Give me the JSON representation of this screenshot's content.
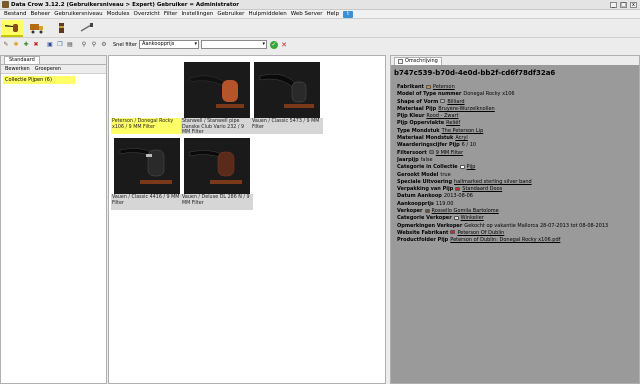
{
  "window": {
    "title": "Data Crow 3.12.2    (Gebruikersniveau > Expert)    Gebruiker = Administrator",
    "minimize_icon": "minimize-icon",
    "maximize_icon": "maximize-icon",
    "close_icon": "close-icon"
  },
  "menubar": {
    "items": [
      "Bestand",
      "Beheer",
      "Gebruikersniveau",
      "Modules",
      "Overzicht",
      "Filter",
      "Instellingen",
      "Gebruiker",
      "Hulpmiddelen",
      "Web Server",
      "Help"
    ],
    "twitter_icon": "twitter-icon"
  },
  "modules": [
    {
      "name": "pipe-module-icon",
      "active": true,
      "color": "#8a4a1a"
    },
    {
      "name": "truck-module-icon",
      "active": false,
      "color": "#b36a10"
    },
    {
      "name": "tobacco-module-icon",
      "active": false,
      "color": "#5a3a20"
    },
    {
      "name": "pipe-tools-module-icon",
      "active": false,
      "color": "#6e6e6e"
    }
  ],
  "toolbar": {
    "filter_label": "Snel filter",
    "filter_field": "Aankoopprijs",
    "filter_value": ""
  },
  "left": {
    "tab": "Standaard",
    "actions": [
      "Bewerken",
      "Groeperen"
    ],
    "tree_item": "Collectie Pijpen (6)"
  },
  "cards": [
    {
      "caption": "Peterson / Donegal Rocky x106 / 9 MM Filter",
      "selected": true,
      "col": 0,
      "row": 0,
      "blank": true,
      "bowl": "#000"
    },
    {
      "caption": "Stanwell / Stanwell pipe Danske Club Vario 232 / 9 MM Filter",
      "selected": false,
      "col": 1,
      "row": 0,
      "blank": false,
      "bowl": "#b5542a"
    },
    {
      "caption": "Vauen / Classic 5473 / 9 MM Filter",
      "selected": false,
      "col": 2,
      "row": 0,
      "blank": false,
      "bowl": "#2a2a2a"
    },
    {
      "caption": "Vauen / Classic 4416 / 9 MM Filter",
      "selected": false,
      "col": 0,
      "row": 1,
      "blank": false,
      "bowl": "#2a2a2a"
    },
    {
      "caption": "Vauen / Deluxe DL 286 N / 9 MM Filter",
      "selected": false,
      "col": 1,
      "row": 1,
      "blank": false,
      "bowl": "#5a2a1a"
    }
  ],
  "right": {
    "tab": "Omschrijving",
    "id": "b747c539-b70d-4e0d-bb2f-cd6f78df32a6",
    "details": [
      {
        "label": "Fabrikant",
        "value": "Peterson",
        "link": true,
        "icon": "#c89040"
      },
      {
        "label": "Model of Type nummer",
        "value": "Donegal Rocky x106",
        "link": false,
        "icon": ""
      },
      {
        "label": "Shape of Vorm",
        "value": "Billiard",
        "link": true,
        "icon": "#b0b0b0"
      },
      {
        "label": "Materiaal Pijp",
        "value": "Bruyère-Wurzelknollen",
        "link": true,
        "icon": ""
      },
      {
        "label": "Pijp Kleur",
        "value": "Rood - Zwart",
        "link": true,
        "icon": ""
      },
      {
        "label": "Pijp Oppervlakte",
        "value": "Reliëf",
        "link": true,
        "icon": ""
      },
      {
        "label": "Type Mondstuk",
        "value": "The Peterson Lip",
        "link": true,
        "icon": ""
      },
      {
        "label": "Materiaal Mondstuk",
        "value": "Acryl",
        "link": true,
        "icon": ""
      },
      {
        "label": "Waarderingscijfer Pijp",
        "value": "6 / 10",
        "link": false,
        "icon": ""
      },
      {
        "label": "Filtersoort",
        "value": "9 MM Filter",
        "link": true,
        "icon": "#7a7a7a"
      },
      {
        "label": "Jaarpijp",
        "value": "false",
        "link": false,
        "icon": ""
      },
      {
        "label": "Categorie in Collectie",
        "value": "Pijp",
        "link": true,
        "icon": "#ffffff"
      },
      {
        "label": "Gerookt Model",
        "value": "true",
        "link": false,
        "icon": ""
      },
      {
        "label": "Speciale Uitvoering",
        "value": "hallmarked sterling silver band",
        "link": true,
        "icon": ""
      },
      {
        "label": "Verpakking van Pijp",
        "value": "Standaard Doos",
        "link": true,
        "icon": "#c03030"
      },
      {
        "label": "Datum Aankoop",
        "value": "2013-08-06",
        "link": false,
        "icon": ""
      },
      {
        "label": "Aankoopprijs",
        "value": "119.00",
        "link": false,
        "icon": ""
      },
      {
        "label": "Verkoper",
        "value": "Rossello Gomila Bartolome",
        "link": true,
        "icon": "#7a4a2a"
      },
      {
        "label": "Categorie Verkoper",
        "value": "Winkelier",
        "link": true,
        "icon": "#e0e0e0"
      },
      {
        "label": "Opmerkingen Verkoper",
        "value": "Gekocht op vakantie Mallorca 28-07-2013 tot 08-08-2013",
        "link": false,
        "icon": ""
      },
      {
        "label": "Website Fabrikant",
        "value": "Peterson Of Dublin",
        "link": true,
        "icon": "#c03030"
      },
      {
        "label": "Productfolder Pijp",
        "value": "Peterson of Dublin: Donegal Rocky x106.pdf",
        "link": true,
        "icon": ""
      }
    ]
  }
}
